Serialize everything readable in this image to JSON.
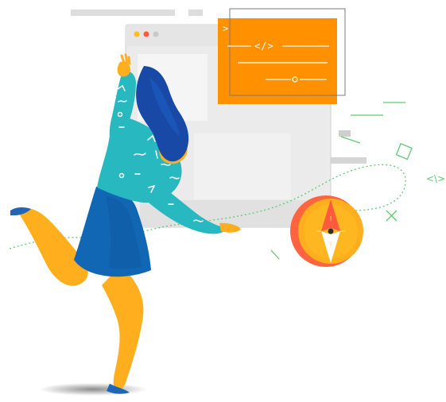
{
  "illustration": {
    "code_icon_text": "</>",
    "cursor_glyph": ">",
    "side_code_mark": "<\\>",
    "colors": {
      "background": "#ffffff",
      "accent_orange": "#ff8a00",
      "accent_orange_light": "#ffb100",
      "accent_red": "#ff5a3d",
      "accent_green": "#5fca76",
      "woman_top": "#27b8c0",
      "woman_skirt": "#1267b5",
      "woman_hair": "#1849a6",
      "skin_yellow": "#ffae1e",
      "window_gray": "#d8d8d8"
    }
  }
}
